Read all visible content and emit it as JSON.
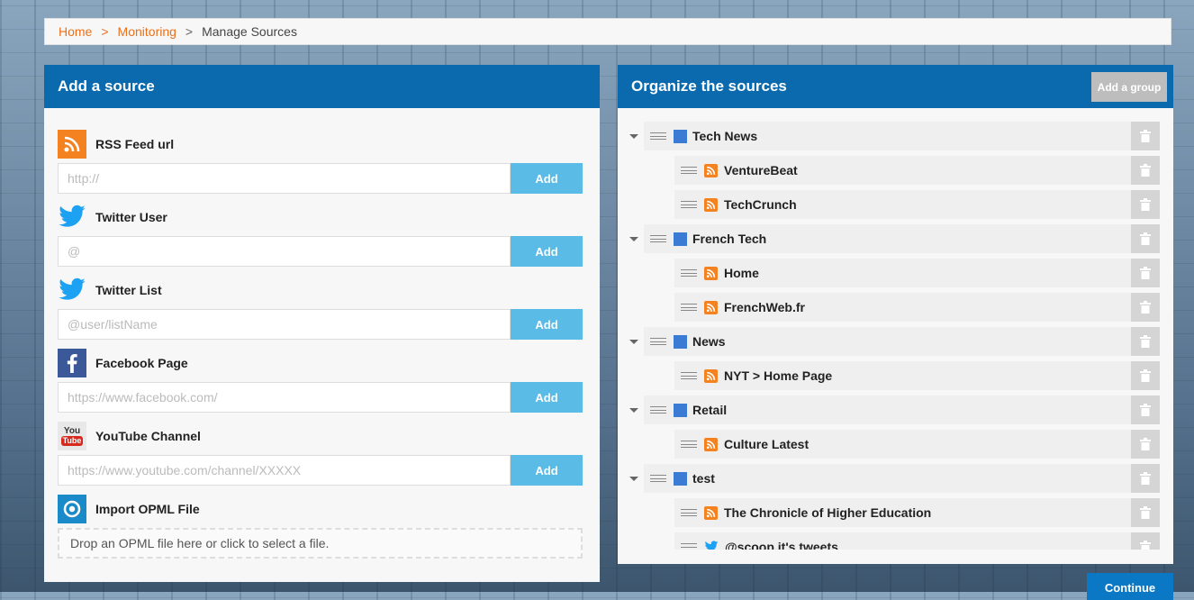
{
  "breadcrumb": {
    "home": "Home",
    "monitoring": "Monitoring",
    "separator": ">",
    "current": "Manage Sources"
  },
  "add_panel": {
    "title": "Add a source",
    "rss": {
      "label": "RSS Feed url",
      "placeholder": "http://",
      "button": "Add"
    },
    "twitter_user": {
      "label": "Twitter User",
      "placeholder": "@",
      "button": "Add"
    },
    "twitter_list": {
      "label": "Twitter List",
      "placeholder": "@user/listName",
      "button": "Add"
    },
    "facebook": {
      "label": "Facebook Page",
      "placeholder": "https://www.facebook.com/",
      "button": "Add"
    },
    "youtube": {
      "label": "YouTube Channel",
      "placeholder": "https://www.youtube.com/channel/XXXXX",
      "button": "Add",
      "icon_top": "You",
      "icon_bottom": "Tube"
    },
    "opml": {
      "label": "Import OPML File",
      "dropzone": "Drop an OPML file here or click to select a file."
    }
  },
  "org_panel": {
    "title": "Organize the sources",
    "add_group": "Add a group",
    "rows": [
      {
        "type": "group",
        "label": "Tech News"
      },
      {
        "type": "source",
        "icon": "rss-icon",
        "label": "VentureBeat"
      },
      {
        "type": "source",
        "icon": "rss-icon",
        "label": "TechCrunch"
      },
      {
        "type": "group",
        "label": "French Tech"
      },
      {
        "type": "source",
        "icon": "rss-icon",
        "label": "Home"
      },
      {
        "type": "source",
        "icon": "rss-icon",
        "label": "FrenchWeb.fr"
      },
      {
        "type": "group",
        "label": "News"
      },
      {
        "type": "source",
        "icon": "rss-icon",
        "label": "NYT > Home Page"
      },
      {
        "type": "group",
        "label": "Retail"
      },
      {
        "type": "source",
        "icon": "rss-icon",
        "label": "Culture Latest"
      },
      {
        "type": "group",
        "label": "test"
      },
      {
        "type": "source",
        "icon": "rss-icon",
        "label": "The Chronicle of Higher Education"
      },
      {
        "type": "source",
        "icon": "twitter-icon",
        "label": "@scoop.it's tweets"
      }
    ]
  },
  "continue_label": "Continue",
  "colors": {
    "header_blue": "#0a6aad",
    "add_button": "#5bbbe7",
    "rss_orange": "#f58220",
    "folder_blue": "#3b7bd4",
    "link_orange": "#e8711c"
  }
}
